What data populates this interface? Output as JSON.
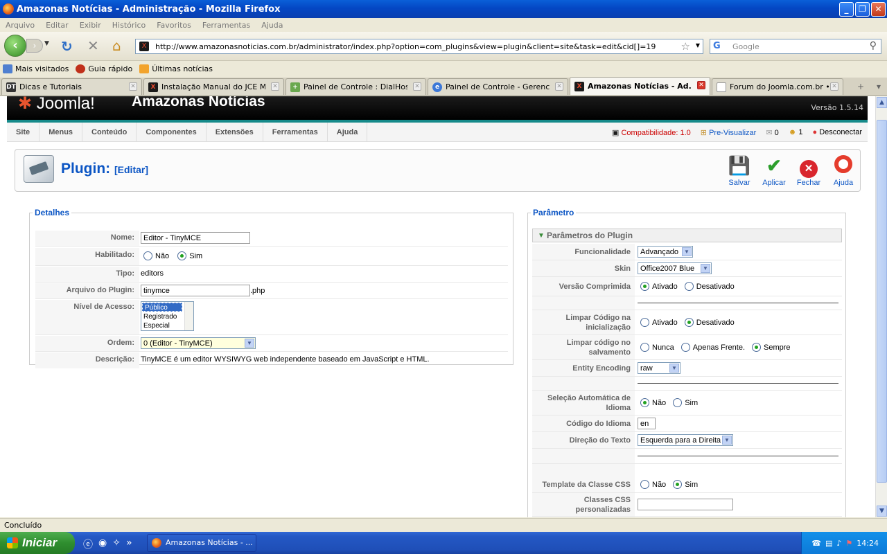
{
  "window": {
    "title": "Amazonas Notícias - Administração - Mozilla Firefox"
  },
  "menubar": [
    "Arquivo",
    "Editar",
    "Exibir",
    "Histórico",
    "Favoritos",
    "Ferramentas",
    "Ajuda"
  ],
  "nav": {
    "url": "http://www.amazonasnoticias.com.br/administrator/index.php?option=com_plugins&view=plugin&client=site&task=edit&cid[]=19",
    "search_placeholder": "Google"
  },
  "bookmarks": [
    "Mais visitados",
    "Guia rápido",
    "Últimas notícias"
  ],
  "tabs": [
    {
      "label": "Dicas e Tutoriais",
      "icon": "DT",
      "color": "#333"
    },
    {
      "label": "Instalação Manual do JCE Ma...",
      "icon": "X",
      "color": "#1b1b1b"
    },
    {
      "label": "Painel de Controle : DialHost I...",
      "icon": "+",
      "color": "#6aa84f"
    },
    {
      "label": "Painel de Controle - Gerencia...",
      "icon": "e",
      "color": "#3c78d8"
    },
    {
      "label": "Amazonas Notícias - Ad...",
      "icon": "X",
      "color": "#1b1b1b",
      "active": true
    },
    {
      "label": "Forum do Joomla.com.br • Po...",
      "icon": "",
      "color": "#ffffff"
    }
  ],
  "joomla": {
    "logo": "Joomla!",
    "site_name": "Amazonas Notícias",
    "version": "Versão 1.5.14",
    "menu": [
      "Site",
      "Menus",
      "Conteúdo",
      "Componentes",
      "Extensões",
      "Ferramentas",
      "Ajuda"
    ],
    "status": {
      "compat": "Compatibilidade: 1.0",
      "preview": "Pre-Visualizar",
      "messages": "0",
      "users": "1",
      "logout": "Desconectar"
    }
  },
  "toolbar": {
    "title": "Plugin:",
    "subtitle": "[Editar]",
    "buttons": {
      "save": "Salvar",
      "apply": "Aplicar",
      "close": "Fechar",
      "help": "Ajuda"
    }
  },
  "details": {
    "legend": "Detalhes",
    "name_label": "Nome:",
    "name_value": "Editor - TinyMCE",
    "enabled_label": "Habilitado:",
    "enabled_no": "Não",
    "enabled_yes": "Sim",
    "type_label": "Tipo:",
    "type_value": "editors",
    "file_label": "Arquivo do Plugin:",
    "file_value": "tinymce",
    "file_ext": ".php",
    "access_label": "Nível de Acesso:",
    "access_options": [
      "Público",
      "Registrado",
      "Especial"
    ],
    "order_label": "Ordem:",
    "order_value": "0 (Editor - TinyMCE)",
    "desc_label": "Descrição:",
    "desc_value": "TinyMCE é um editor WYSIWYG web independente baseado em JavaScript e HTML."
  },
  "params": {
    "legend": "Parâmetro",
    "header": "Parâmetros do Plugin",
    "functionality_label": "Funcionalidade",
    "functionality_value": "Advançado",
    "skin_label": "Skin",
    "skin_value": "Office2007 Blue",
    "compressed_label": "Versão Comprimida",
    "on": "Ativado",
    "off": "Desativado",
    "cleanup_init_label": "Limpar Código na inicialização",
    "cleanup_save_label": "Limpar código no salvamento",
    "never": "Nunca",
    "front_only": "Apenas Frente.",
    "always": "Sempre",
    "entity_label": "Entity Encoding",
    "entity_value": "raw",
    "auto_lang_label": "Seleção Automática de Idioma",
    "no": "Não",
    "yes": "Sim",
    "lang_code_label": "Código do Idioma",
    "lang_code_value": "en",
    "text_dir_label": "Direção do Texto",
    "text_dir_value": "Esquerda para a Direita",
    "css_template_label": "Template da Classe CSS",
    "custom_css_label": "Classes CSS personalizadas"
  },
  "statusbar": "Concluído",
  "taskbar": {
    "start": "Iniciar",
    "item": "Amazonas Notícias - ...",
    "clock": "14:24"
  }
}
